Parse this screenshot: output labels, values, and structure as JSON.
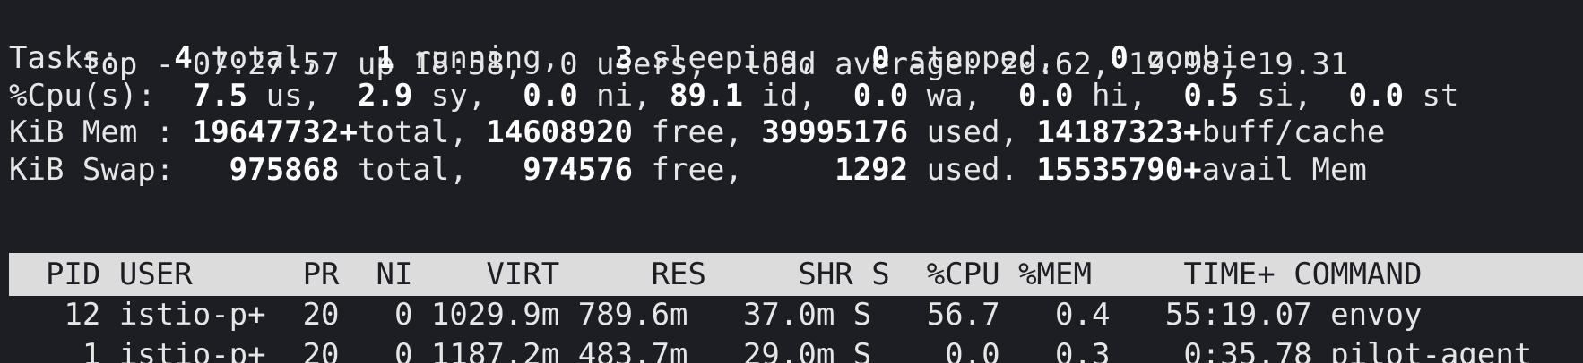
{
  "summary": {
    "uptime_line": "top - 07:27:57 up 18:58,  0 users,  load average: 20.62, 19.98, 19.31",
    "tasks": {
      "label": "Tasks:",
      "total": "4",
      "total_label": " total,",
      "running": "1",
      "running_label": " running,",
      "sleeping": "3",
      "sleeping_label": " sleeping,",
      "stopped": "0",
      "stopped_label": " stopped,",
      "zombie": "0",
      "zombie_label": " zombie"
    },
    "cpu": {
      "label": "%Cpu(s):",
      "us": "7.5",
      "us_label": " us,",
      "sy": "2.9",
      "sy_label": " sy,",
      "ni": "0.0",
      "ni_label": " ni,",
      "id": "89.1",
      "id_label": " id,",
      "wa": "0.0",
      "wa_label": " wa,",
      "hi": "0.0",
      "hi_label": " hi,",
      "si": "0.5",
      "si_label": " si,",
      "st": "0.0",
      "st_label": " st"
    },
    "mem": {
      "label": "KiB Mem :",
      "total": "19647732+",
      "total_label": "total,",
      "free": "14608920",
      "free_label": " free,",
      "used": "39995176",
      "used_label": " used,",
      "buff": "14187323+",
      "buff_label": "buff/cache"
    },
    "swap": {
      "label": "KiB Swap:",
      "total": "975868",
      "total_label": " total,",
      "free": "974576",
      "free_label": " free,",
      "used": "1292",
      "used_label": " used.",
      "avail": "15535790+",
      "avail_label": "avail Mem"
    }
  },
  "table": {
    "headers": {
      "pid": "PID",
      "user": "USER",
      "pr": "PR",
      "ni": "NI",
      "virt": "VIRT",
      "res": "RES",
      "shr": "SHR",
      "s": "S",
      "cpu": "%CPU",
      "mem": "%MEM",
      "time": "TIME+",
      "command": "COMMAND"
    },
    "rows": [
      {
        "pid": "12",
        "user": "istio-p+",
        "pr": "20",
        "ni": "0",
        "virt": "1029.9m",
        "res": "789.6m",
        "shr": "37.0m",
        "s": "S",
        "cpu": "56.7",
        "mem": "0.4",
        "time": "55:19.07",
        "command": "envoy"
      },
      {
        "pid": "1",
        "user": "istio-p+",
        "pr": "20",
        "ni": "0",
        "virt": "1187.2m",
        "res": "483.7m",
        "shr": "29.0m",
        "s": "S",
        "cpu": "0.0",
        "mem": "0.3",
        "time": "0:35.78",
        "command": "pilot-agent"
      }
    ]
  },
  "colors": {
    "background": "#1c1e24",
    "foreground": "#e6e6e6",
    "header_bar": "#dcdcdc"
  }
}
